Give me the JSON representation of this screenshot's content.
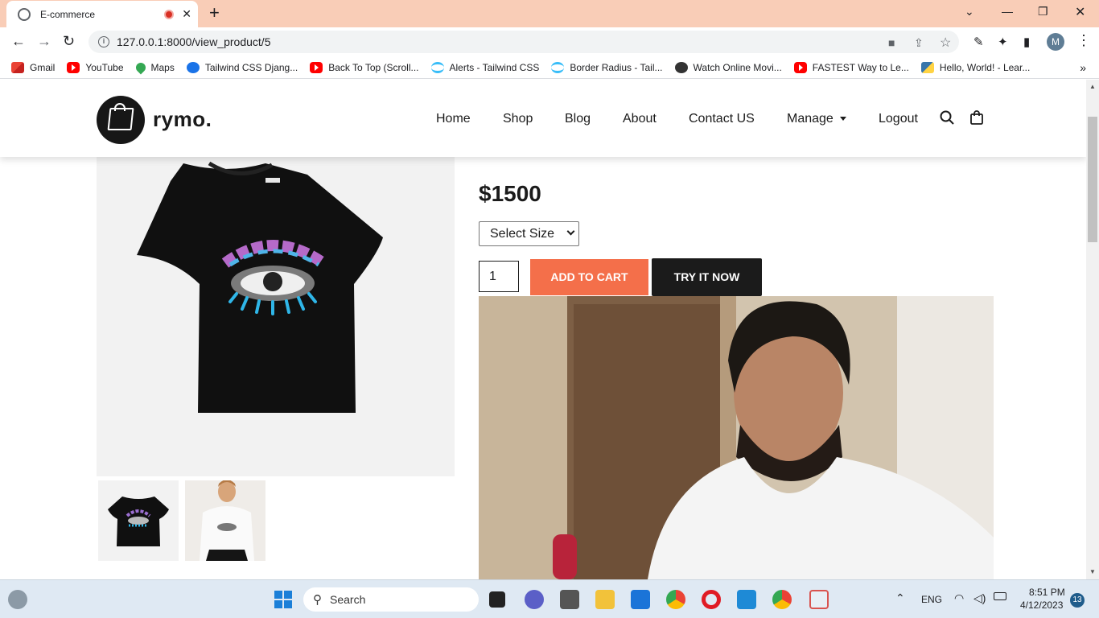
{
  "browser": {
    "tab_title": "E-commerce",
    "new_tab_symbol": "+",
    "url": "127.0.0.1:8000/view_product/5",
    "profile_initial": "M",
    "bookmarks": [
      {
        "label": "Gmail",
        "icon": "gmail-icon"
      },
      {
        "label": "YouTube",
        "icon": "youtube-icon"
      },
      {
        "label": "Maps",
        "icon": "maps-icon"
      },
      {
        "label": "Tailwind CSS Djang...",
        "icon": "play-icon"
      },
      {
        "label": "Back To Top (Scroll...",
        "icon": "youtube-icon"
      },
      {
        "label": "Alerts - Tailwind CSS",
        "icon": "tailwind-icon"
      },
      {
        "label": "Border Radius - Tail...",
        "icon": "tailwind-icon"
      },
      {
        "label": "Watch Online Movi...",
        "icon": "film-icon"
      },
      {
        "label": "FASTEST Way to Le...",
        "icon": "youtube-icon"
      },
      {
        "label": "Hello, World! - Lear...",
        "icon": "python-icon"
      }
    ]
  },
  "site": {
    "brand": "rymo.",
    "nav": [
      "Home",
      "Shop",
      "Blog",
      "About",
      "Contact US",
      "Manage",
      "Logout"
    ]
  },
  "product": {
    "price": "$1500",
    "size_select": "Select Size",
    "quantity": "1",
    "add_to_cart": "ADD TO CART",
    "try_it_now": "TRY IT NOW"
  },
  "taskbar": {
    "search_placeholder": "Search",
    "language": "ENG",
    "time": "8:51 PM",
    "date": "4/12/2023",
    "notification_count": "13"
  },
  "colors": {
    "tab_strip": "#f9cdb7",
    "add_to_cart": "#f46f4a",
    "try_it_now": "#1b1b1b"
  }
}
